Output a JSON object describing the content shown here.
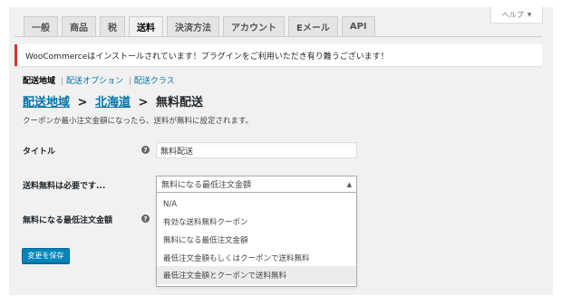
{
  "help": {
    "label": "ヘルプ",
    "caret": "▼"
  },
  "tabs": [
    {
      "label": "一般"
    },
    {
      "label": "商品"
    },
    {
      "label": "税"
    },
    {
      "label": "送料",
      "active": true
    },
    {
      "label": "決済方法"
    },
    {
      "label": "アカウント"
    },
    {
      "label": "Eメール"
    },
    {
      "label": "API"
    }
  ],
  "notice": {
    "text": "WooCommerceはインストールされています！プラグインをご利用いただき有り難うございます！"
  },
  "subnav": {
    "current": "配送地域",
    "links": [
      "配送オプション",
      "配送クラス"
    ],
    "separator": "|"
  },
  "heading": {
    "link1": "配送地域",
    "link2": "北海道",
    "separator": ">",
    "title": "無料配送"
  },
  "description": "クーポンか最小注文金額になったら、送料が無料に設定されます。",
  "fields": {
    "title": {
      "label": "タイトル",
      "value": "無料配送",
      "tip": "?"
    },
    "requires": {
      "label": "送料無料は必要です...",
      "selected": "無料になる最低注文金額",
      "arrow": "▲",
      "options": [
        "N/A",
        "有効な送料無料クーポン",
        "無料になる最低注文金額",
        "最低注文金額もしくはクーポンで送料無料",
        "最低注文金額とクーポンで送料無料"
      ],
      "highlighted_index": 4
    },
    "min_amount": {
      "label": "無料になる最低注文金額",
      "tip": "?"
    }
  },
  "save_button": "変更を保存",
  "colors": {
    "primary": "#0085ba",
    "link": "#0073aa",
    "notice_border": "#dc3232"
  }
}
